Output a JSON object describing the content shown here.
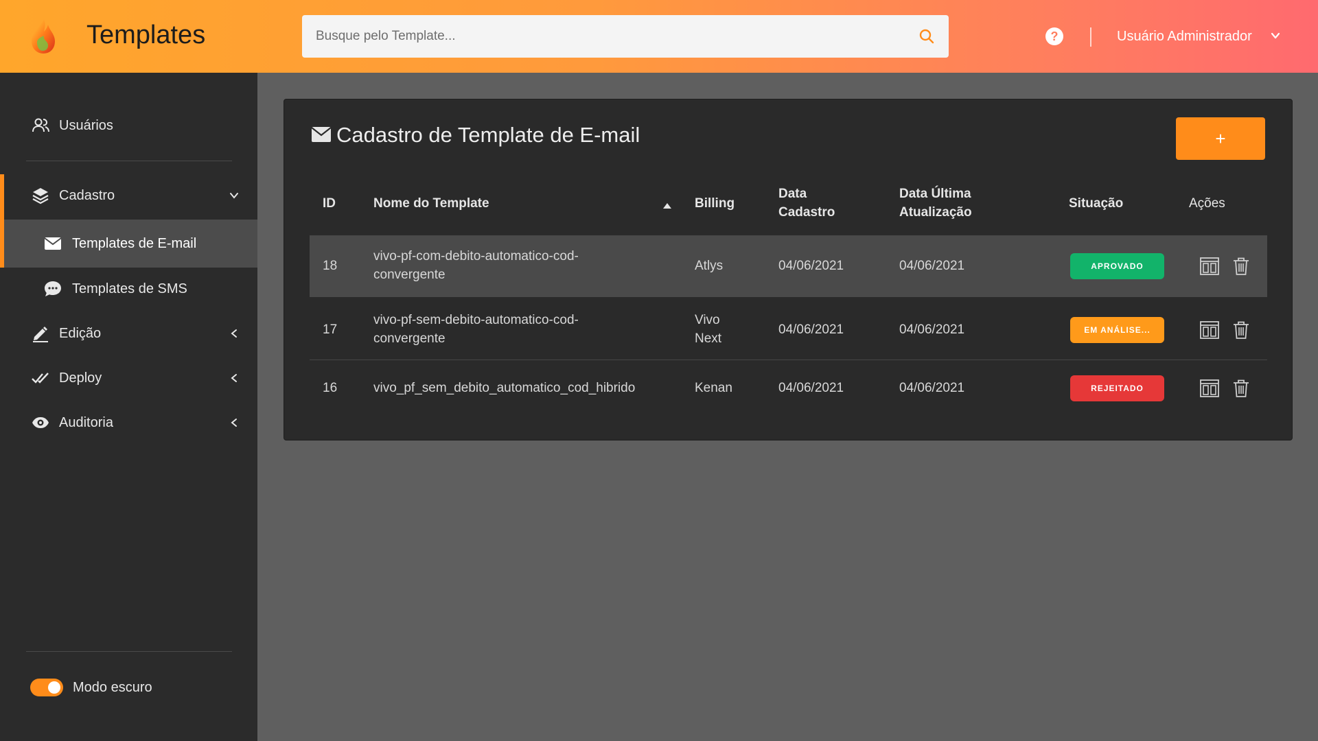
{
  "header": {
    "title": "Templates",
    "search_placeholder": "Busque pelo Template...",
    "help_label": "?",
    "user_name": "Usuário Administrador"
  },
  "sidebar": {
    "items": [
      {
        "label": "Usuários",
        "icon": "users-icon"
      },
      {
        "label": "Cadastro",
        "icon": "layers-icon",
        "expanded": true
      },
      {
        "label": "Templates de E-mail",
        "icon": "envelope-icon",
        "active": true
      },
      {
        "label": "Templates de SMS",
        "icon": "chat-bubble-icon"
      },
      {
        "label": "Edição",
        "icon": "pencil-icon"
      },
      {
        "label": "Deploy",
        "icon": "double-check-icon"
      },
      {
        "label": "Auditoria",
        "icon": "eye-icon"
      }
    ],
    "dark_mode_label": "Modo escuro",
    "dark_mode_on": true
  },
  "panel": {
    "title": "Cadastro de Template de E-mail",
    "add_label": "+",
    "columns": {
      "id": "ID",
      "name": "Nome do Template",
      "billing": "Billing",
      "created_1": "Data",
      "created_2": "Cadastro",
      "updated_1": "Data Última",
      "updated_2": "Atualização",
      "status": "Situação",
      "actions": "Ações"
    },
    "rows": [
      {
        "id": "18",
        "name_1": "vivo-pf-com-debito-automatico-cod-",
        "name_2": "convergente",
        "billing_1": "Atlys",
        "billing_2": "",
        "created": "04/06/2021",
        "updated": "04/06/2021",
        "status": "APROVADO"
      },
      {
        "id": "17",
        "name_1": "vivo-pf-sem-debito-automatico-cod-",
        "name_2": "convergente",
        "billing_1": "Vivo",
        "billing_2": "Next",
        "created": "04/06/2021",
        "updated": "04/06/2021",
        "status": "EM ANÁLISE..."
      },
      {
        "id": "16",
        "name_1": "vivo_pf_sem_debito_automatico_cod_hibrido",
        "name_2": "",
        "billing_1": "Kenan",
        "billing_2": "",
        "created": "04/06/2021",
        "updated": "04/06/2021",
        "status": "REJEITADO"
      }
    ]
  },
  "colors": {
    "accent": "#ff8c1a",
    "approved": "#12b36a",
    "pending": "#ff9a1a",
    "rejected": "#e63838"
  }
}
